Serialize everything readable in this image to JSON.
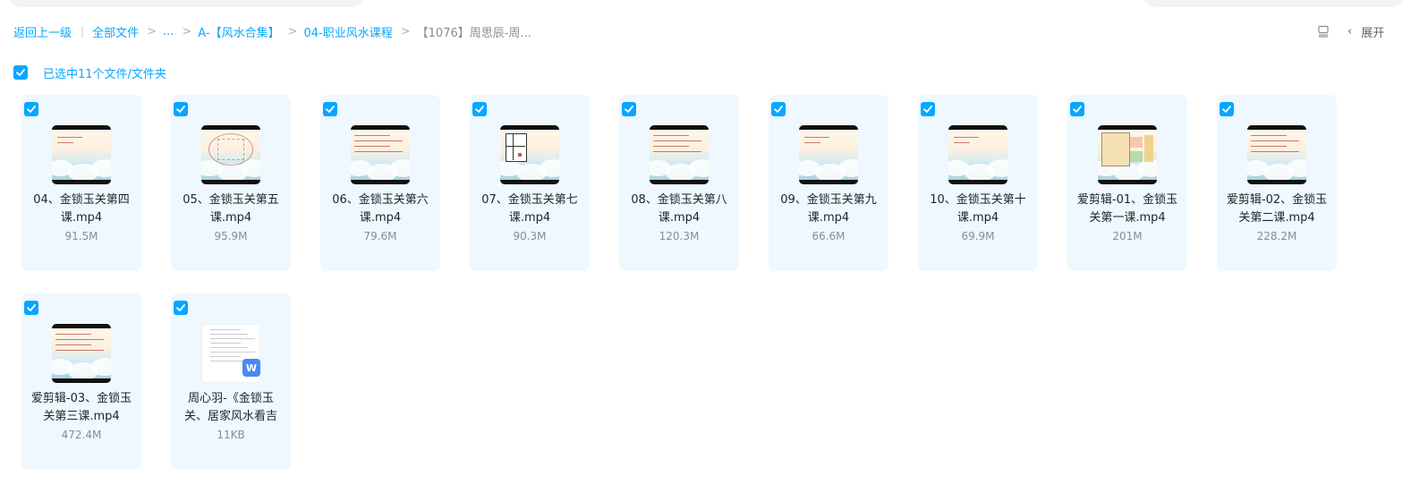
{
  "breadcrumb": {
    "back": "返回上一级",
    "items": [
      "全部文件",
      "...",
      "A-【风水合集】",
      "04-职业风水课程",
      "【1076】周思辰-周..."
    ]
  },
  "toolbar": {
    "list_icon": "list-view-icon",
    "chevron": "‹",
    "expand_label": "展开"
  },
  "selection": {
    "text": "已选中11个文件/文件夹",
    "checked": true
  },
  "files": [
    {
      "name": "04、金锁玉关第四课.mp4",
      "size": "91.5M",
      "type": "video",
      "thumb": "slide"
    },
    {
      "name": "05、金锁玉关第五课.mp4",
      "size": "95.9M",
      "type": "video",
      "thumb": "chart"
    },
    {
      "name": "06、金锁玉关第六课.mp4",
      "size": "79.6M",
      "type": "video",
      "thumb": "text"
    },
    {
      "name": "07、金锁玉关第七课.mp4",
      "size": "90.3M",
      "type": "video",
      "thumb": "floorplan"
    },
    {
      "name": "08、金锁玉关第八课.mp4",
      "size": "120.3M",
      "type": "video",
      "thumb": "text"
    },
    {
      "name": "09、金锁玉关第九课.mp4",
      "size": "66.6M",
      "type": "video",
      "thumb": "slide"
    },
    {
      "name": "10、金锁玉关第十课.mp4",
      "size": "69.9M",
      "type": "video",
      "thumb": "slide"
    },
    {
      "name": "爱剪辑-01、金锁玉关第一课.mp4",
      "size": "201M",
      "type": "video",
      "thumb": "floorplan-color"
    },
    {
      "name": "爱剪辑-02、金锁玉关第二课.mp4",
      "size": "228.2M",
      "type": "video",
      "thumb": "text"
    },
    {
      "name": "爱剪辑-03、金锁玉关第三课.mp4",
      "size": "472.4M",
      "type": "video",
      "thumb": "text"
    },
    {
      "name": "周心羽-《金锁玉关、居家风水看吉",
      "size": "11KB",
      "type": "word",
      "thumb": "doc",
      "badge": "W"
    }
  ],
  "colors": {
    "accent": "#06a7ff",
    "card_bg": "#eef8fe",
    "muted": "#878c9c",
    "word": "#4a88f5"
  }
}
